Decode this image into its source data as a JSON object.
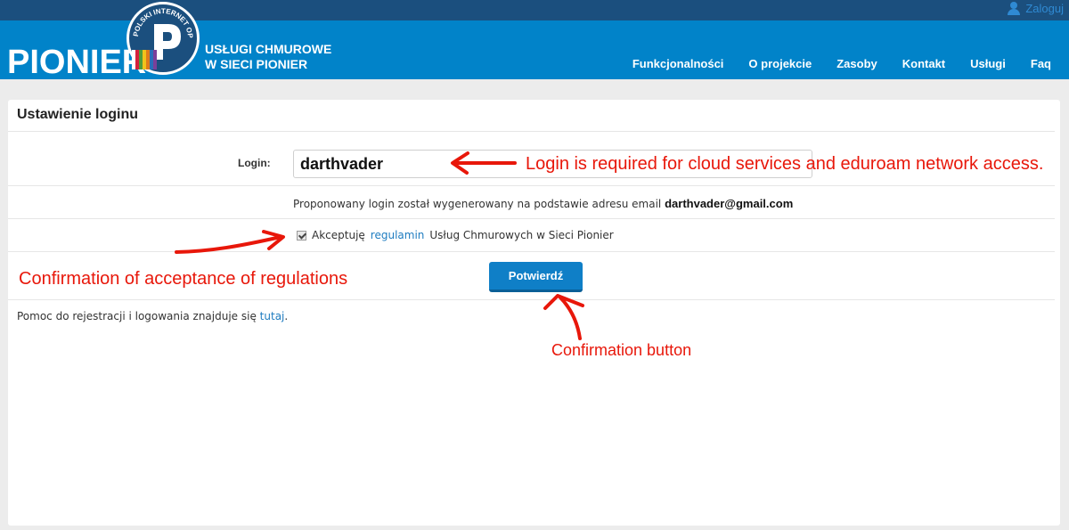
{
  "topbar": {
    "login_label": "Zaloguj",
    "login_icon": "user-icon"
  },
  "header": {
    "logo_text": "PIONIER",
    "logo_ring_text": "POLSKI INTERNET OPTYCZNY",
    "service_title_line1": "USŁUGI CHMUROWE",
    "service_title_line2": "W SIECI PIONIER",
    "nav": [
      {
        "label": "Funkcjonalności"
      },
      {
        "label": "O projekcie"
      },
      {
        "label": "Zasoby"
      },
      {
        "label": "Kontakt"
      },
      {
        "label": "Usługi"
      },
      {
        "label": "Faq"
      }
    ]
  },
  "main": {
    "title": "Ustawienie loginu",
    "login_label": "Login:",
    "login_value": "darthvader",
    "proposal_text": "Proponowany login został wygenerowany na podstawie adresu email",
    "proposal_email": "darthvader@gmail.com",
    "accept_prefix": "Akceptuję",
    "accept_link": "regulamin",
    "accept_suffix": "Usług Chmurowych w Sieci Pionier",
    "accept_checked": true,
    "confirm_label": "Potwierdź",
    "help_prefix": "Pomoc do rejestracji i logowania znajduje się",
    "help_link": "tutaj",
    "help_suffix": "."
  },
  "annotations": {
    "login_note": "Login is required for cloud services and eduroam network access.",
    "regulations_note": "Confirmation of acceptance of regulations",
    "button_note": "Confirmation button",
    "color": "#e8170a"
  },
  "colors": {
    "topbar": "#1b4f7e",
    "header": "#0183c9",
    "button": "#0f7fc7",
    "link": "#1e7cc0"
  }
}
